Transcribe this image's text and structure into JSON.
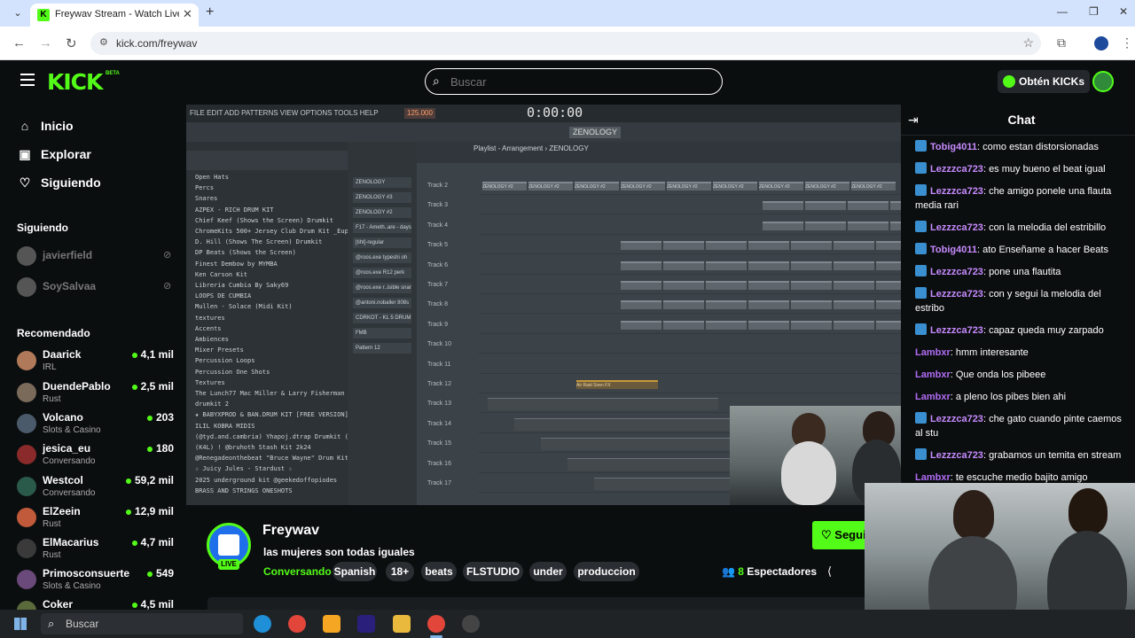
{
  "browser": {
    "tab_title": "Freywav Stream - Watch Live o",
    "url": "kick.com/freywav"
  },
  "header": {
    "logo": "KICK",
    "logo_badge": "BETA",
    "search_placeholder": "Buscar",
    "get_kicks": "Obtén KICKs"
  },
  "sidebar": {
    "nav": [
      {
        "label": "Inicio",
        "icon": "home-icon"
      },
      {
        "label": "Explorar",
        "icon": "explore-icon"
      },
      {
        "label": "Siguiendo",
        "icon": "heart-icon"
      }
    ],
    "following_title": "Siguiendo",
    "following": [
      {
        "name": "javierfield"
      },
      {
        "name": "SoySalvaa"
      }
    ],
    "recommended_title": "Recomendado",
    "recommended": [
      {
        "name": "Daarick",
        "category": "IRL",
        "viewers": "4,1 mil",
        "color": "#b07a5a"
      },
      {
        "name": "DuendePablo",
        "category": "Rust",
        "viewers": "2,5 mil",
        "color": "#7a6a5a"
      },
      {
        "name": "Volcano",
        "category": "Slots & Casino",
        "viewers": "203",
        "color": "#4a5a6a"
      },
      {
        "name": "jesica_eu",
        "category": "Conversando",
        "viewers": "180",
        "color": "#8a2a2a"
      },
      {
        "name": "Westcol",
        "category": "Conversando",
        "viewers": "59,2 mil",
        "color": "#2a5a4a"
      },
      {
        "name": "ElZeein",
        "category": "Rust",
        "viewers": "12,9 mil",
        "color": "#c05a3a"
      },
      {
        "name": "ElMacarius",
        "category": "Rust",
        "viewers": "4,7 mil",
        "color": "#3a3a3a"
      },
      {
        "name": "Primosconsuerte",
        "category": "Slots & Casino",
        "viewers": "549",
        "color": "#6a4a7a"
      },
      {
        "name": "Coker",
        "category": "",
        "viewers": "4,5 mil",
        "color": "#5a6a3a"
      }
    ]
  },
  "player": {
    "fl": {
      "menu": "FILE EDIT ADD PATTERNS VIEW OPTIONS TOOLS HELP",
      "time": "0:00:00",
      "tempo": "125.000",
      "playlist_title": "Playlist - Arrangement › ZENOLOGY",
      "pattern": "ZENOLOGY",
      "browser_items": [
        "Open Hats",
        "Percs",
        "Snares",
        "AZPEX - RICH DRUM KIT",
        "Chief Keef (Shows the Screen) Drumkit",
        "ChromeKits 500+ Jersey Club Drum Kit _Euphoria_",
        "D. Hill (Shows The Screen) Drumkit",
        "DP Beats (Shows the Screen)",
        "Finest Dembow by MYMBA",
        "Ken Carson Kit",
        "Libreria Cumbia By Saky69",
        "LOOPS DE CUMBIA",
        "Mullen - Solace (Midi Kit)",
        "textures",
        "Accents",
        "Ambiences",
        "Mixer Presets",
        "Percussion Loops",
        "Percussion One Shots",
        "Textures",
        "The Lunch77 Mac Miller & Larry Fisherman Drumkit",
        "drumkit 2",
        "★ BABYXPROD & BAN.DRUM KIT [FREE VERSION]",
        "ILIL KOBRA MIDIS",
        "(@tyd.and.cambria) Yhapoj.dtrap Drumkit (Rare Shit)",
        "(K4L) ! @bruhoth Stash Kit 2k24",
        "@Renegadeonthebeat \"Bruce Wayne\" Drum Kit",
        "☆ Juicy Jules - Stardust ☆",
        "2025 underground kit @geekedoffopiodes",
        "BRASS AND STRINGS ONESHOTS"
      ],
      "channels": [
        "ZENOLOGY",
        "ZENOLOGY #3",
        "ZENOLOGY #2",
        "F17 - Ameth..are - days",
        "[tiht]-regular",
        "@roos.exe typeshi oh",
        "@roos.exe R12 perk",
        "@roos.exe r..isible snare",
        "@antoni.noballer 808s",
        "CDRKOT - KL 5 DRUM KIT",
        "FMB",
        "Pattern 12"
      ],
      "tracks": [
        "Track 2",
        "Track 3",
        "Track 4",
        "Track 5",
        "Track 6",
        "Track 7",
        "Track 8",
        "Track 9",
        "Track 10",
        "Track 11",
        "Track 12",
        "Track 13",
        "Track 14",
        "Track 15",
        "Track 16",
        "Track 17"
      ],
      "clip_label": "ZENOLOGY #2",
      "clip_orange": "Air Raid Siren FX"
    }
  },
  "stream": {
    "streamer": "Freywav",
    "live_badge": "LIVE",
    "title": "las mujeres son todas iguales",
    "category": "Conversando",
    "tags": [
      "Spanish",
      "18+",
      "beats",
      "FLSTUDIO",
      "under",
      "produccion"
    ],
    "viewer_count": "8",
    "viewer_label": "Espectadores",
    "follow_label": "Segui"
  },
  "chat": {
    "title": "Chat",
    "messages": [
      {
        "user": "Tobig4011",
        "text": "como estan distorsionadas",
        "color": "#ffffff",
        "badge": true
      },
      {
        "user": "Lezzzca723",
        "text": "es muy bueno el beat igual",
        "color": "#ffffff",
        "badge": true
      },
      {
        "user": "Lezzzca723",
        "text": "che amigo ponele una flauta media rari",
        "color": "#ffffff",
        "badge": true
      },
      {
        "user": "Lezzzca723",
        "text": "con la melodia del estribillo",
        "color": "#ffffff",
        "badge": true
      },
      {
        "user": "Tobig4011",
        "text": "ato Enseñame a hacer Beats",
        "color": "#ffffff",
        "badge": true
      },
      {
        "user": "Lezzzca723",
        "text": "pone una flautita",
        "color": "#ffffff",
        "badge": true
      },
      {
        "user": "Lezzzca723",
        "text": "con y segui la melodia del estribo",
        "color": "#ffffff",
        "badge": true
      },
      {
        "user": "Lezzzca723",
        "text": "capaz queda muy zarpado",
        "color": "#ffffff",
        "badge": true
      },
      {
        "user": "Lambxr",
        "text": "hmm interesante",
        "color": "#b06cf5",
        "badge": false
      },
      {
        "user": "Lambxr",
        "text": "Que onda los pibeee",
        "color": "#b06cf5",
        "badge": false
      },
      {
        "user": "Lambxr",
        "text": "a pleno los pibes bien ahi",
        "color": "#b06cf5",
        "badge": false
      },
      {
        "user": "Lezzzca723",
        "text": "che gato cuando pinte caemos al stu",
        "color": "#ffffff",
        "badge": true
      },
      {
        "user": "Lezzzca723",
        "text": "grabamos un temita en stream",
        "color": "#ffffff",
        "badge": true
      },
      {
        "user": "Lambxr",
        "text": "te escuche medio bajito amigo",
        "color": "#b06cf5",
        "badge": false
      }
    ]
  },
  "taskbar": {
    "search_placeholder": "Buscar"
  },
  "colors": {
    "accent": "#53fc18",
    "background": "#0b0e0f",
    "username_chat": "#c78bff"
  }
}
